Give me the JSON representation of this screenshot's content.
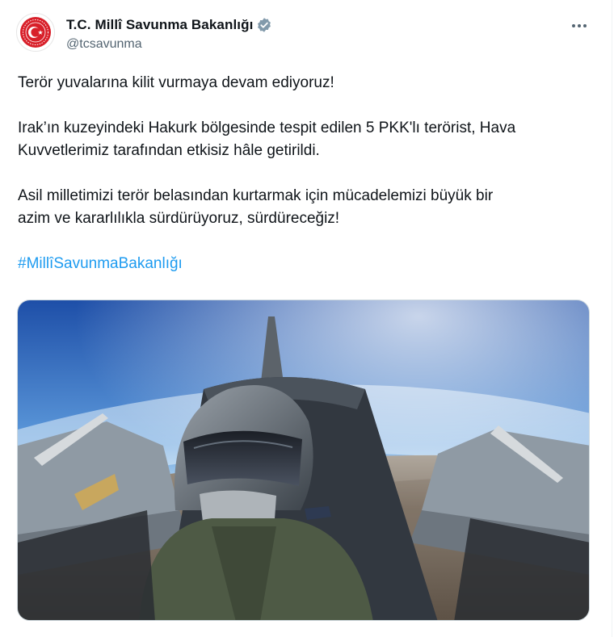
{
  "author": {
    "display_name": "T.C. Millî Savunma Bakanlığı",
    "handle": "@tcsavunma",
    "verified": true,
    "avatar_icon": "ministry-seal-icon",
    "seal_color": "#d8202a"
  },
  "menu": {
    "icon": "more-options-icon"
  },
  "tweet": {
    "line1": "Terör yuvalarına kilit vurmaya devam ediyoruz!",
    "para2_line1": "Irak’ın kuzeyindeki Hakurk bölgesinde tespit edilen 5 PKK'lı terörist, Hava",
    "para2_line2": "Kuvvetlerimiz tarafından etkisiz hâle getirildi.",
    "para3_line1": "Asil milletimizi terör belasından kurtarmak için mücadelemizi büyük bir",
    "para3_line2": "azim ve kararlılıkla sürdürüyoruz, sürdüreceğiz!",
    "hashtag": "#MillîSavunmaBakanlığı"
  },
  "media": {
    "type": "photo",
    "subject": "fighter-jet-cockpit-pilot-photo"
  },
  "colors": {
    "link": "#1d9bf0",
    "verified": "#829aab",
    "text": "#0f1419",
    "secondary": "#536471"
  }
}
